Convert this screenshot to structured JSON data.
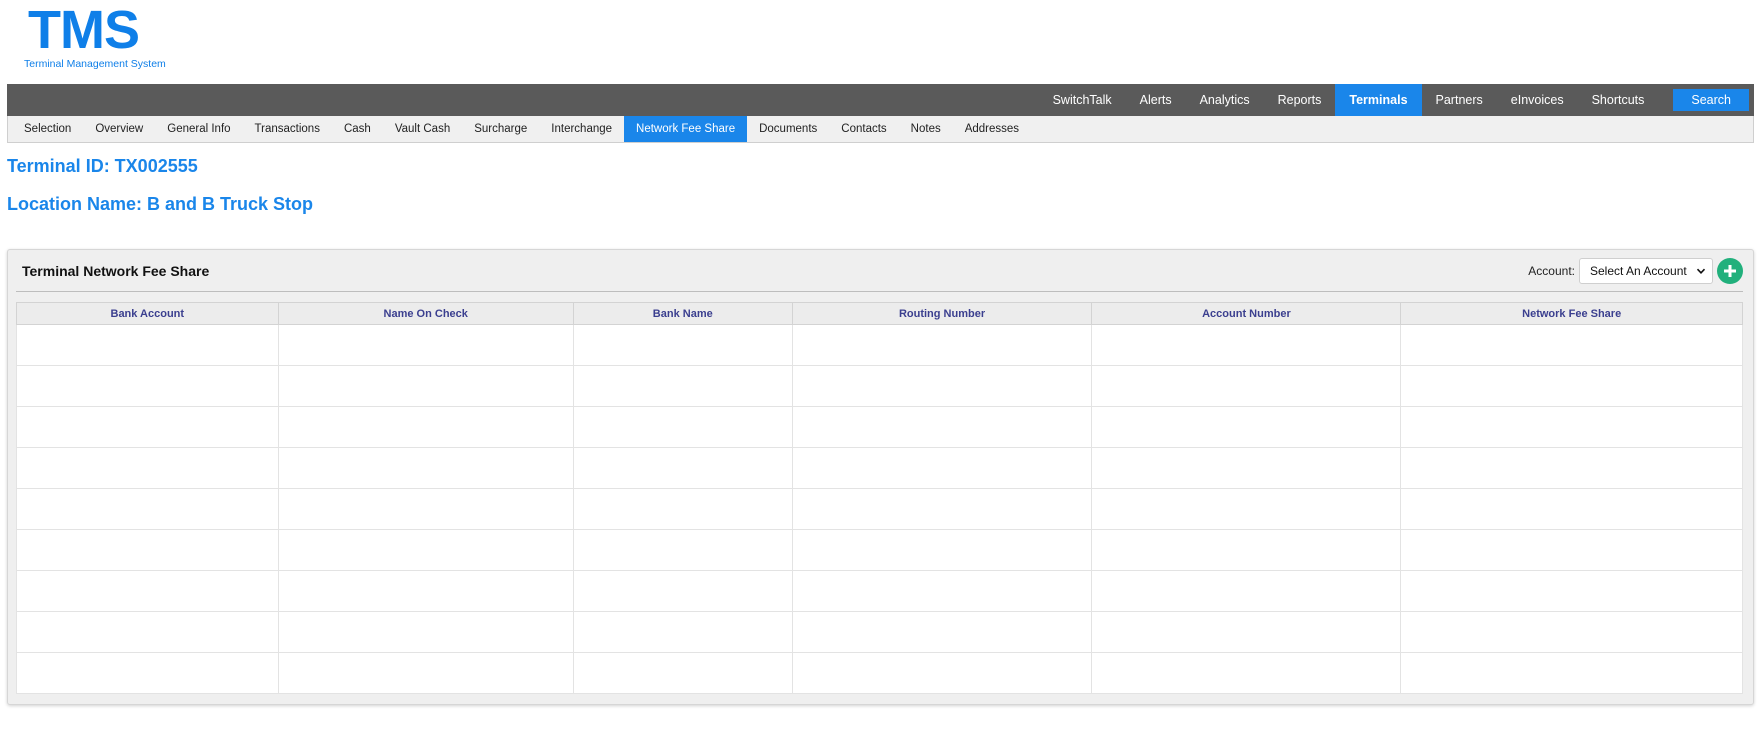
{
  "logo": {
    "main": "TMS",
    "sub": "Terminal Management System"
  },
  "topnav": {
    "items": [
      {
        "label": "SwitchTalk",
        "active": false
      },
      {
        "label": "Alerts",
        "active": false
      },
      {
        "label": "Analytics",
        "active": false
      },
      {
        "label": "Reports",
        "active": false
      },
      {
        "label": "Terminals",
        "active": true
      },
      {
        "label": "Partners",
        "active": false
      },
      {
        "label": "eInvoices",
        "active": false
      },
      {
        "label": "Shortcuts",
        "active": false
      }
    ],
    "search_label": "Search"
  },
  "subnav": {
    "items": [
      {
        "label": "Selection",
        "active": false
      },
      {
        "label": "Overview",
        "active": false
      },
      {
        "label": "General Info",
        "active": false
      },
      {
        "label": "Transactions",
        "active": false
      },
      {
        "label": "Cash",
        "active": false
      },
      {
        "label": "Vault Cash",
        "active": false
      },
      {
        "label": "Surcharge",
        "active": false
      },
      {
        "label": "Interchange",
        "active": false
      },
      {
        "label": "Network Fee Share",
        "active": true
      },
      {
        "label": "Documents",
        "active": false
      },
      {
        "label": "Contacts",
        "active": false
      },
      {
        "label": "Notes",
        "active": false
      },
      {
        "label": "Addresses",
        "active": false
      }
    ]
  },
  "header": {
    "terminal_id": "Terminal ID: TX002555",
    "location_name": "Location Name: B and B Truck Stop"
  },
  "panel": {
    "title": "Terminal Network Fee Share",
    "account_label": "Account:",
    "account_select_value": "Select An Account"
  },
  "table": {
    "columns": [
      "Bank Account",
      "Name On Check",
      "Bank Name",
      "Routing Number",
      "Account Number",
      "Network Fee Share"
    ],
    "rows": [
      [
        "",
        "",
        "",
        "",
        "",
        ""
      ],
      [
        "",
        "",
        "",
        "",
        "",
        ""
      ],
      [
        "",
        "",
        "",
        "",
        "",
        ""
      ],
      [
        "",
        "",
        "",
        "",
        "",
        ""
      ],
      [
        "",
        "",
        "",
        "",
        "",
        ""
      ],
      [
        "",
        "",
        "",
        "",
        "",
        ""
      ],
      [
        "",
        "",
        "",
        "",
        "",
        ""
      ],
      [
        "",
        "",
        "",
        "",
        "",
        ""
      ],
      [
        "",
        "",
        "",
        "",
        "",
        ""
      ]
    ]
  },
  "colors": {
    "brand_blue": "#1a86ea",
    "nav_bg": "#5a5a5a",
    "add_green": "#21b07c",
    "header_text": "#3b3f8f"
  },
  "icons": {
    "add": "plus-circle-icon",
    "dropdown": "chevron-down-icon"
  }
}
